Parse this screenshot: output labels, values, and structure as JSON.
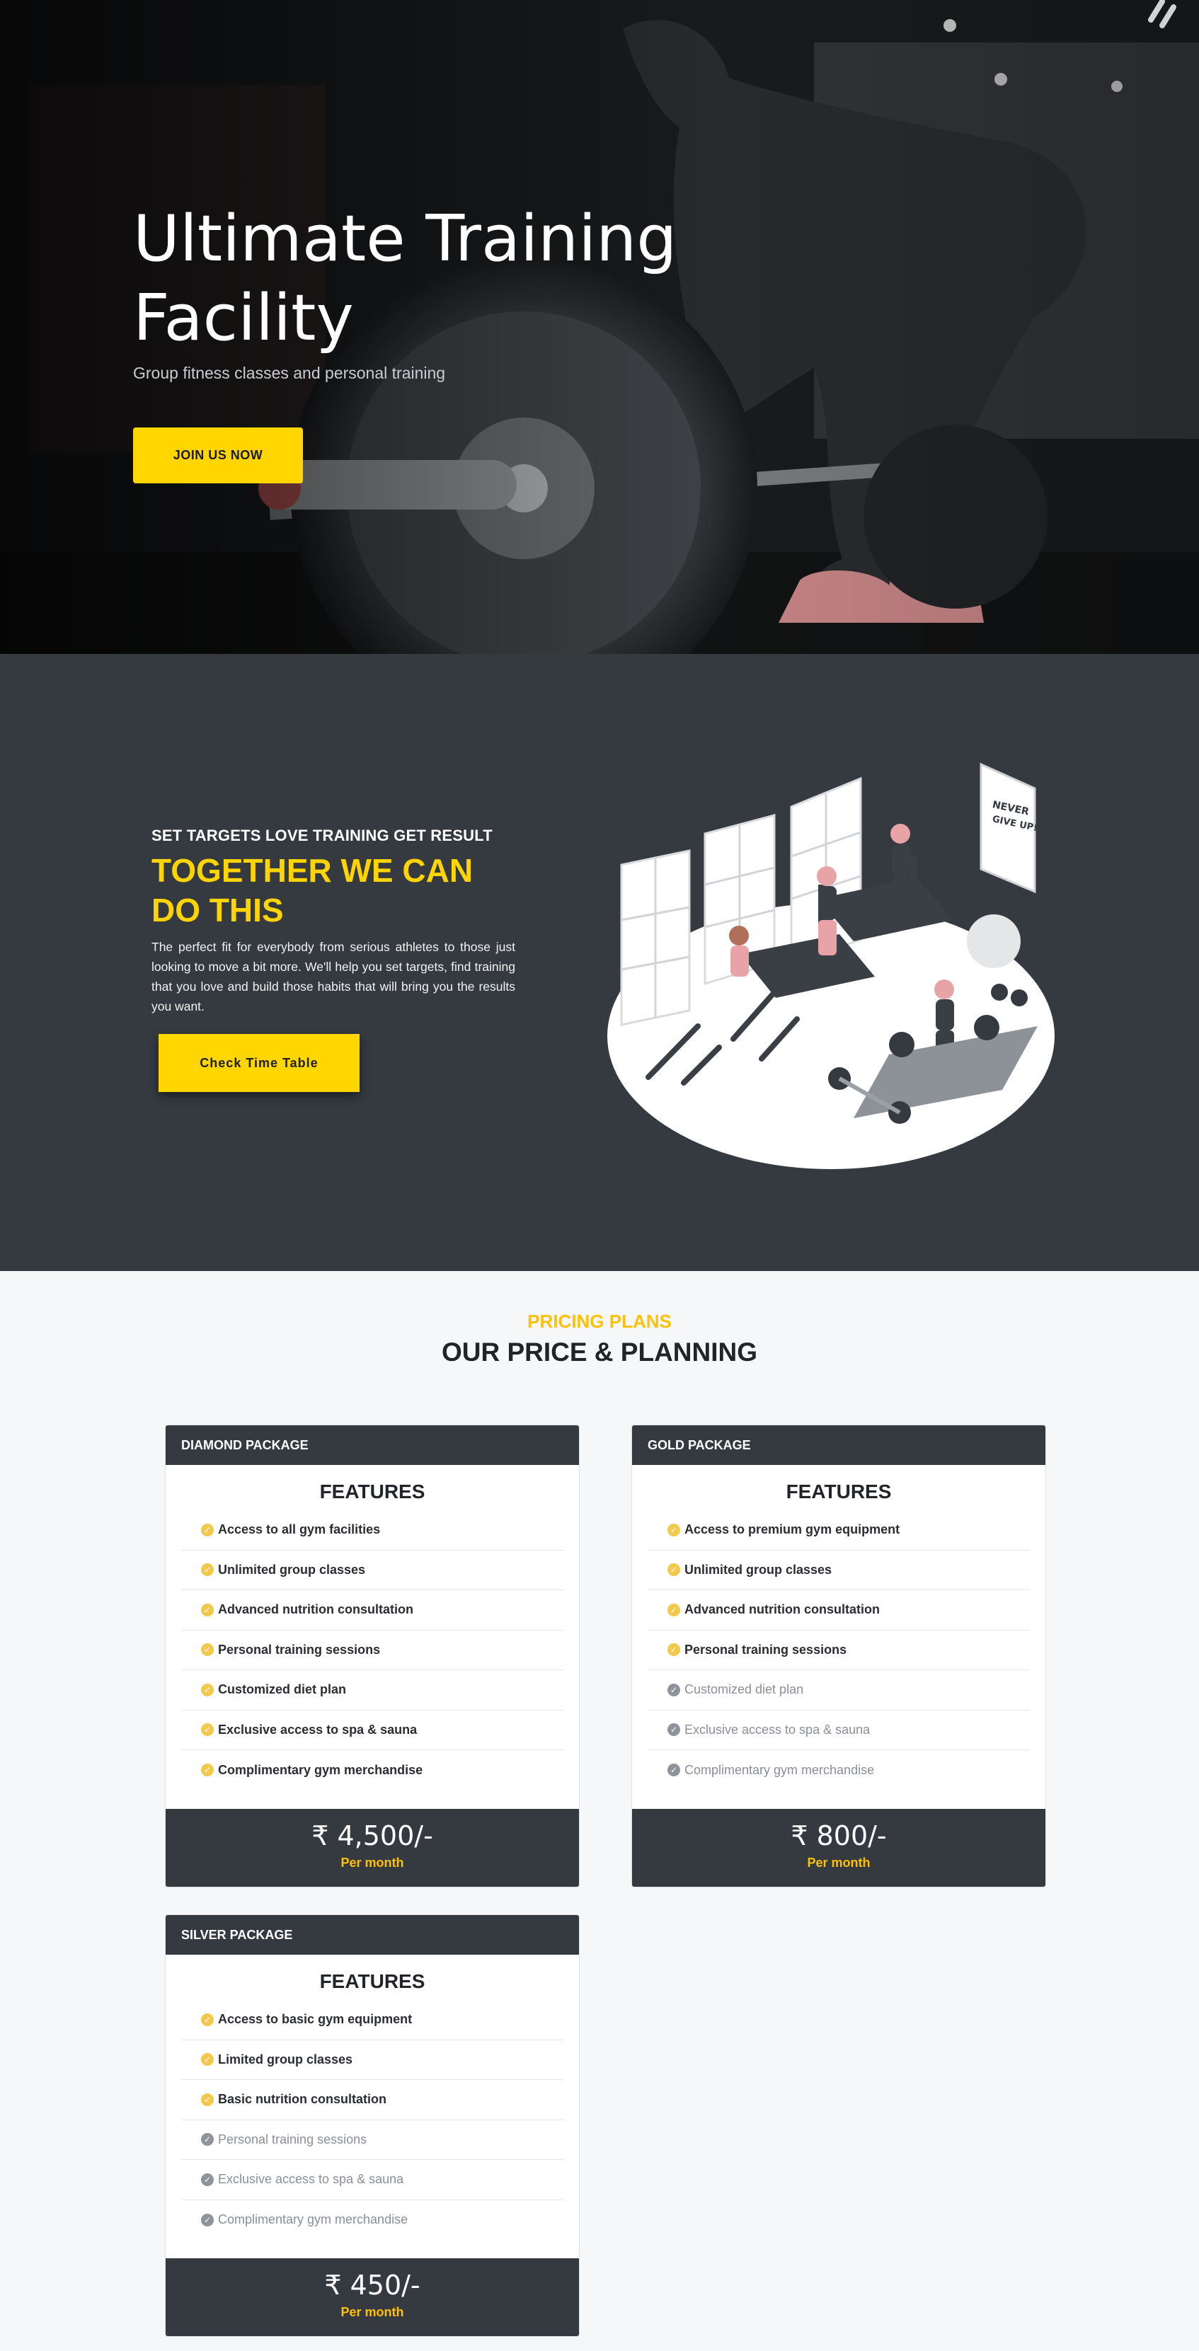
{
  "hero": {
    "title": "Ultimate Training Facility",
    "subtitle": "Group fitness classes and personal training",
    "cta_label": "JOIN US NOW"
  },
  "about": {
    "kicker": "SET TARGETS LOVE TRAINING GET RESULT",
    "title": "TOGETHER WE CAN DO THIS",
    "text": "The perfect fit for everybody from serious athletes to those just looking to move a bit more. We'll help you set targets, find training that you love and build those habits that will bring you the results you want.",
    "cta_label": "Check Time Table",
    "poster_text": "NEVER GIVE UP!"
  },
  "pricing": {
    "kicker": "PRICING PLANS",
    "title": "OUR PRICE & PLANNING",
    "features_heading": "FEATURES",
    "per_label": "Per month",
    "plans": [
      {
        "name": "DIAMOND PACKAGE",
        "price": "₹ 4,500/-",
        "features": [
          {
            "label": "Access to all gym facilities",
            "included": true
          },
          {
            "label": "Unlimited group classes",
            "included": true
          },
          {
            "label": "Advanced nutrition consultation",
            "included": true
          },
          {
            "label": "Personal training sessions",
            "included": true
          },
          {
            "label": "Customized diet plan",
            "included": true
          },
          {
            "label": "Exclusive access to spa & sauna",
            "included": true
          },
          {
            "label": "Complimentary gym merchandise",
            "included": true
          }
        ]
      },
      {
        "name": "GOLD PACKAGE",
        "price": "₹ 800/-",
        "features": [
          {
            "label": "Access to premium gym equipment",
            "included": true
          },
          {
            "label": "Unlimited group classes",
            "included": true
          },
          {
            "label": "Advanced nutrition consultation",
            "included": true
          },
          {
            "label": "Personal training sessions",
            "included": true
          },
          {
            "label": "Customized diet plan",
            "included": false
          },
          {
            "label": "Exclusive access to spa & sauna",
            "included": false
          },
          {
            "label": "Complimentary gym merchandise",
            "included": false
          }
        ]
      },
      {
        "name": "SILVER PACKAGE",
        "price": "₹ 450/-",
        "features": [
          {
            "label": "Access to basic gym equipment",
            "included": true
          },
          {
            "label": "Limited group classes",
            "included": true
          },
          {
            "label": "Basic nutrition consultation",
            "included": true
          },
          {
            "label": "Personal training sessions",
            "included": false
          },
          {
            "label": "Exclusive access to spa & sauna",
            "included": false
          },
          {
            "label": "Complimentary gym merchandise",
            "included": false
          }
        ]
      }
    ]
  },
  "colors": {
    "accent": "#ffd600",
    "dark": "#343a40",
    "muted_check": "#8f949a"
  }
}
